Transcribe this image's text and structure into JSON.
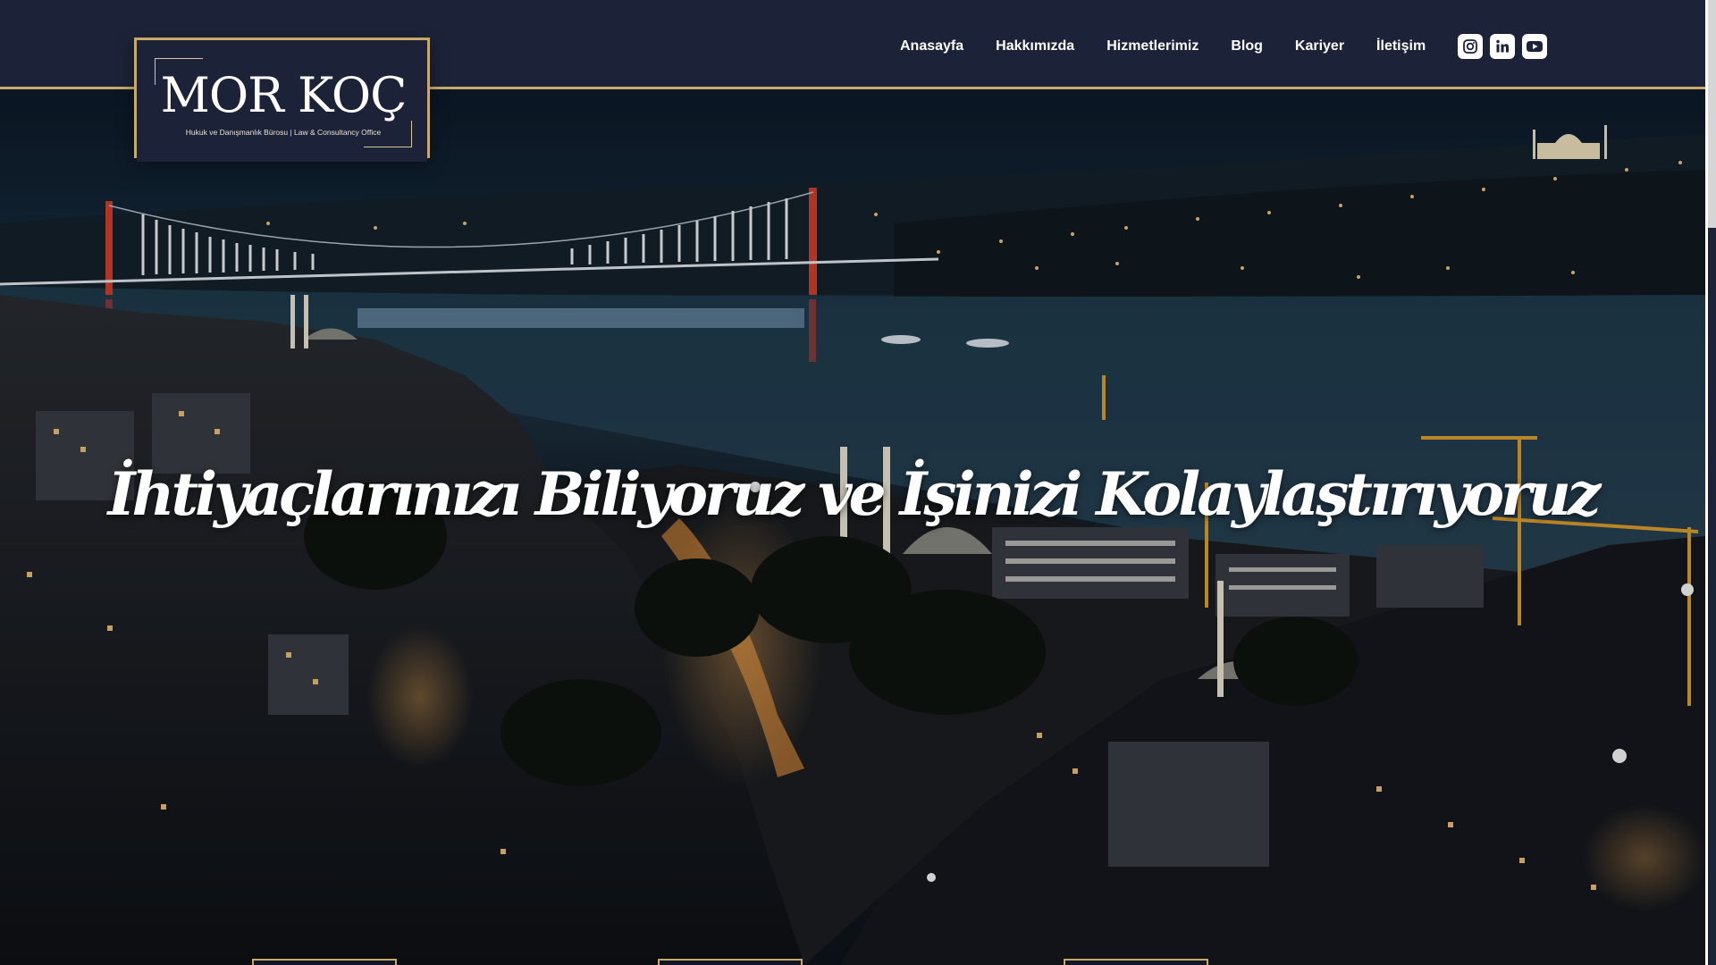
{
  "brand": {
    "name": "MOR KOÇ",
    "tagline": "Hukuk ve Danışmanlık Bürosu | Law & Consultancy Office"
  },
  "nav": {
    "items": [
      {
        "label": "Anasayfa"
      },
      {
        "label": "Hakkımızda"
      },
      {
        "label": "Hizmetlerimiz"
      },
      {
        "label": "Blog"
      },
      {
        "label": "Kariyer"
      },
      {
        "label": "İletişim"
      }
    ]
  },
  "social": {
    "icons": [
      "instagram-icon",
      "linkedin-icon",
      "youtube-icon"
    ]
  },
  "hero": {
    "headline": "İhtiyaçlarınızı Biliyoruz ve İşinizi Kolaylaştırıyoruz"
  },
  "colors": {
    "navy": "#1c2237",
    "gold": "#c9a96a",
    "text": "#ffffff"
  }
}
